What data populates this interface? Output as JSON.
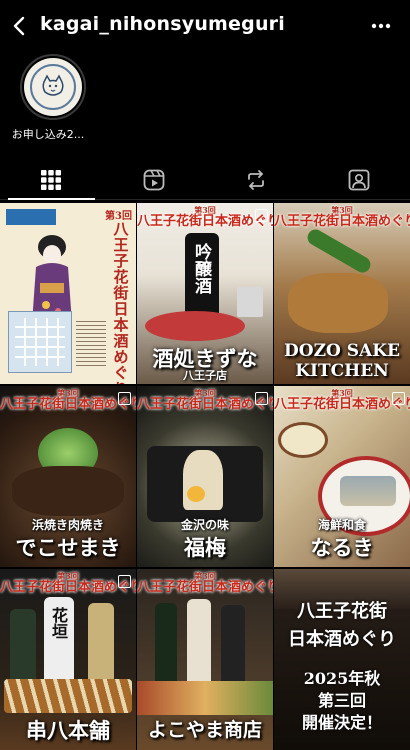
{
  "header": {
    "username": "kagai_nihonsyumeguri",
    "back_icon": "chevron-left-icon",
    "more_icon": "more-horizontal-icon"
  },
  "highlight": {
    "label": "お申し込み2..."
  },
  "tabs": [
    {
      "name": "grid",
      "icon": "grid-icon",
      "active": true
    },
    {
      "name": "reels",
      "icon": "reels-icon",
      "active": false
    },
    {
      "name": "reposts",
      "icon": "repost-icon",
      "active": false
    },
    {
      "name": "tagged",
      "icon": "tagged-user-icon",
      "active": false
    }
  ],
  "posts": [
    {
      "poster_title": "八王子花街日本酒めぐり",
      "poster_badge": "第3回"
    },
    {
      "banner_small": "第3回",
      "banner": "八王子花街日本酒めぐり",
      "sub": "八王子店",
      "caption": "酒処きずな",
      "bottle_text": "吟醸酒"
    },
    {
      "banner_small": "第3回",
      "banner": "八王子花街日本酒めぐり",
      "caption_line1": "DOZO SAKE",
      "caption_line2": "KITCHEN"
    },
    {
      "banner_small": "第3回",
      "banner": "八王子花街日本酒めぐり",
      "sub": "浜焼き肉焼き",
      "caption": "でこせまき"
    },
    {
      "banner_small": "第3回",
      "banner": "八王子花街日本酒めぐり",
      "sub": "金沢の味",
      "caption": "福梅"
    },
    {
      "banner_small": "第3回",
      "banner": "八王子花街日本酒めぐり",
      "sub": "海鮮和食",
      "caption": "なるき"
    },
    {
      "banner_small": "第3回",
      "banner": "八王子花街日本酒めぐり",
      "caption": "串八本舗",
      "bottle_text": "花垣"
    },
    {
      "banner_small": "第3回",
      "banner": "八王子花街日本酒めぐり",
      "caption": "よこやま商店"
    },
    {
      "line1": "八王子花街",
      "line2": "日本酒めぐり",
      "line3": "2025年秋",
      "line4": "第三回",
      "line5": "開催決定！"
    }
  ]
}
